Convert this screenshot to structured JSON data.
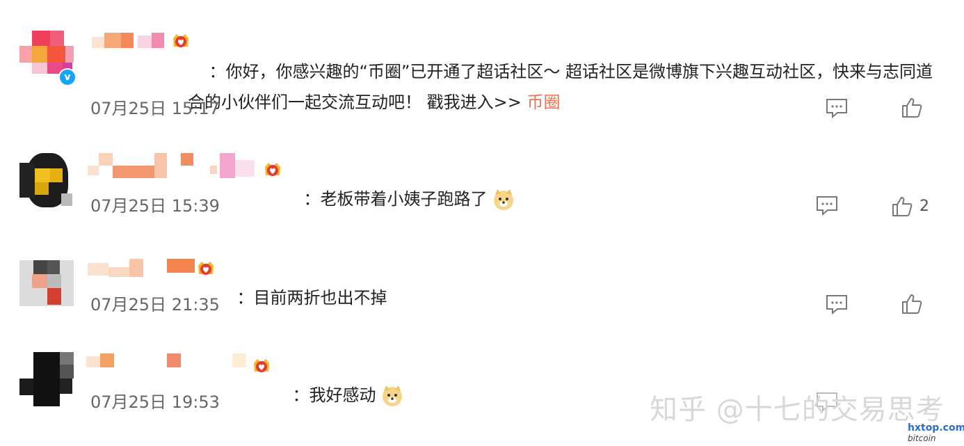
{
  "comments": [
    {
      "username": "",
      "text": "：你好，你感兴趣的“币圈”已开通了超话社区～ 超话社区是微博旗下兴趣互动社区，快来与志同道合的小伙伴们一起交流互动吧！ 戳我进入>> ",
      "link_text": "币圈",
      "time": "07月25日 15:17",
      "likes": "",
      "verified_badge": "v"
    },
    {
      "username": "",
      "text": "：老板带着小姨子跑路了",
      "emoji": "doge-emoji",
      "time": "07月25日 15:39",
      "likes": "2"
    },
    {
      "username": "",
      "text": "：目前两折也出不掉",
      "time": "07月25日 21:35",
      "likes": ""
    },
    {
      "username": "",
      "text": "：我好感动",
      "emoji": "doge-emoji",
      "time": "07月25日 19:53",
      "likes": ""
    }
  ],
  "icons": {
    "reply": "comment-icon",
    "like": "thumbs-up-icon",
    "badge": "crown-heart-badge-icon"
  },
  "colors": {
    "link": "#eb7350",
    "time": "#666666",
    "text": "#222222",
    "verified": "#1aa3f5"
  },
  "watermark": "知乎 @十七的交易思考",
  "site_mark": "hxtop.com",
  "site_mark_sub": "bitcoin"
}
